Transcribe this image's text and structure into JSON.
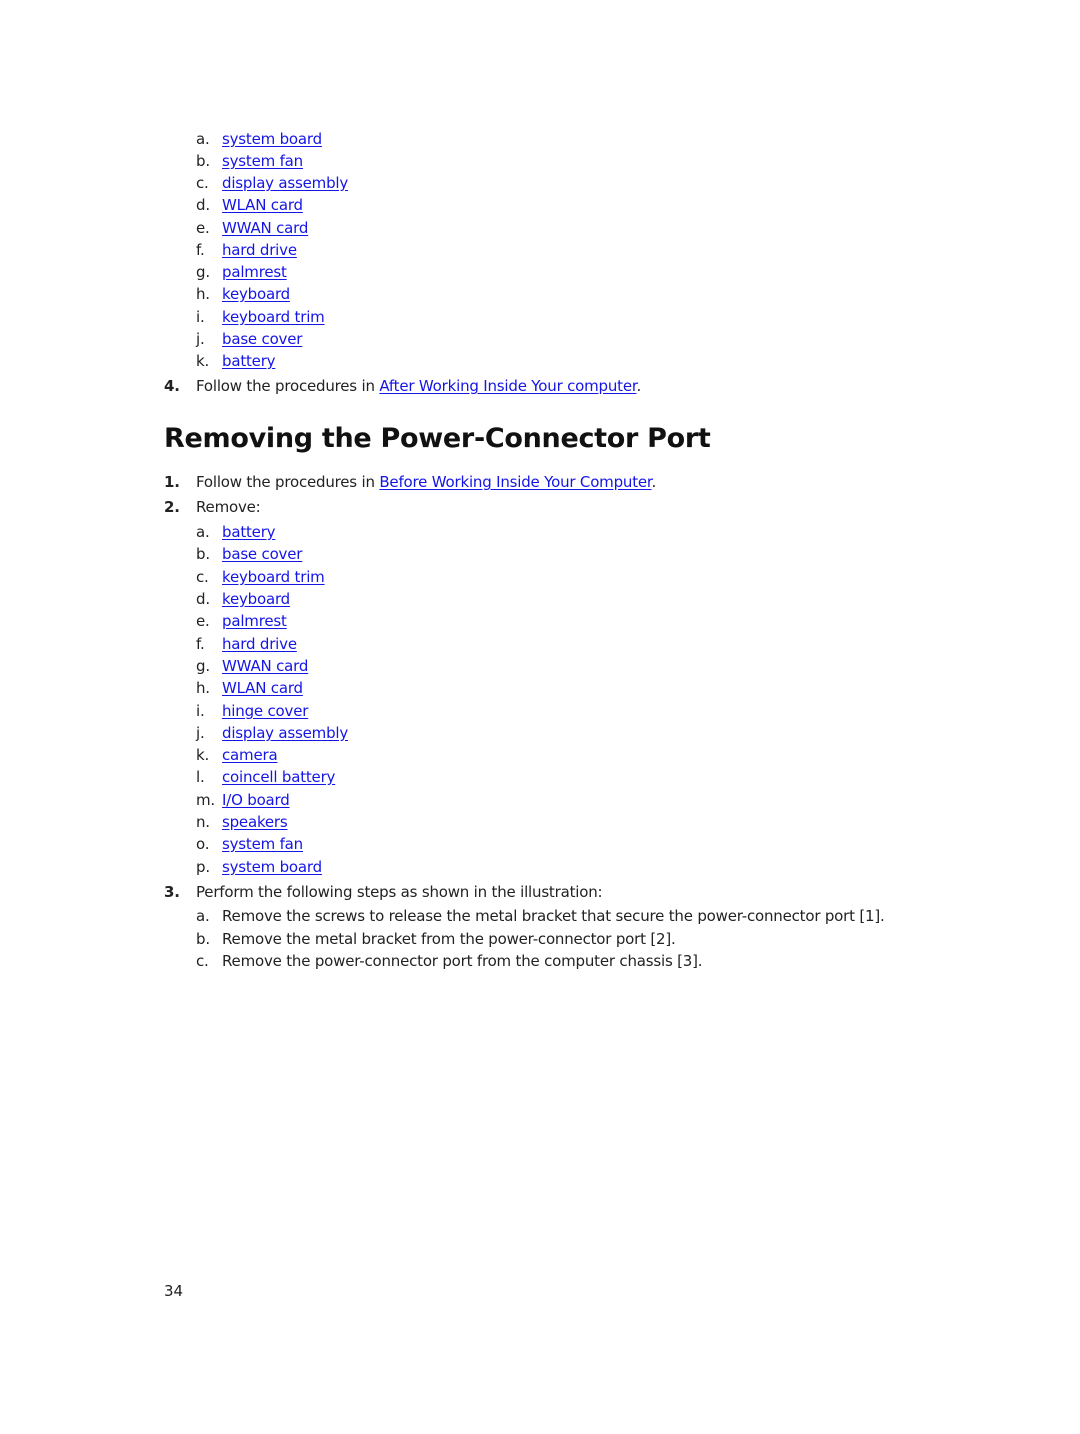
{
  "top_list": {
    "items": [
      {
        "label": "a.",
        "text": "system board"
      },
      {
        "label": "b.",
        "text": "system fan"
      },
      {
        "label": "c.",
        "text": "display assembly"
      },
      {
        "label": "d.",
        "text": "WLAN card"
      },
      {
        "label": "e.",
        "text": "WWAN card"
      },
      {
        "label": "f.",
        "text": "hard drive"
      },
      {
        "label": "g.",
        "text": "palmrest"
      },
      {
        "label": "h.",
        "text": "keyboard"
      },
      {
        "label": "i.",
        "text": "keyboard trim"
      },
      {
        "label": "j.",
        "text": "base cover"
      },
      {
        "label": "k.",
        "text": "battery"
      }
    ]
  },
  "step4": {
    "number": "4.",
    "prefix": "Follow the procedures in ",
    "link": "After Working Inside Your computer",
    "suffix": "."
  },
  "section": {
    "title": "Removing the Power-Connector Port",
    "step1": {
      "number": "1.",
      "prefix": "Follow the procedures in ",
      "link": "Before Working Inside Your Computer",
      "suffix": "."
    },
    "step2": {
      "number": "2.",
      "text": "Remove:",
      "items": [
        {
          "label": "a.",
          "text": "battery"
        },
        {
          "label": "b.",
          "text": "base cover"
        },
        {
          "label": "c.",
          "text": "keyboard trim"
        },
        {
          "label": "d.",
          "text": "keyboard"
        },
        {
          "label": "e.",
          "text": "palmrest"
        },
        {
          "label": "f.",
          "text": "hard drive"
        },
        {
          "label": "g.",
          "text": "WWAN card"
        },
        {
          "label": "h.",
          "text": "WLAN card"
        },
        {
          "label": "i.",
          "text": "hinge cover"
        },
        {
          "label": "j.",
          "text": "display assembly"
        },
        {
          "label": "k.",
          "text": "camera"
        },
        {
          "label": "l.",
          "text": "coincell battery"
        },
        {
          "label": "m.",
          "text": "I/O board"
        },
        {
          "label": "n.",
          "text": "speakers"
        },
        {
          "label": "o.",
          "text": "system fan"
        },
        {
          "label": "p.",
          "text": "system board"
        }
      ]
    },
    "step3": {
      "number": "3.",
      "text": "Perform the following steps as shown in the illustration:",
      "items": [
        {
          "label": "a.",
          "text": "Remove the screws to release the metal bracket that secure the power-connector port [1]."
        },
        {
          "label": "b.",
          "text": "Remove the metal bracket from the power-connector port [2]."
        },
        {
          "label": "c.",
          "text": "Remove the power-connector port from the computer chassis [3]."
        }
      ]
    }
  },
  "footer": {
    "page_number": "34"
  },
  "colors": {
    "link": "#1515e6",
    "text": "#222222"
  }
}
